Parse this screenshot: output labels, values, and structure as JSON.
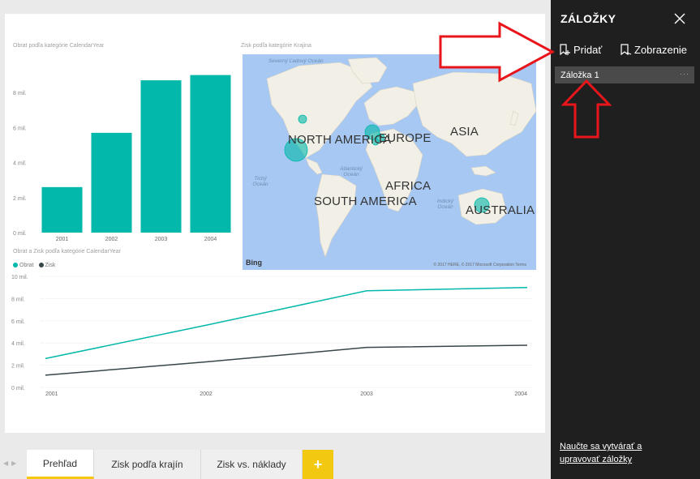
{
  "report": {
    "bar_title": "Obrat podľa kategórie CalendarYear",
    "map_title": "Zisk podľa kategórie Krajina",
    "line_title": "Obrat a Zisk podľa kategórie CalendarYear"
  },
  "map": {
    "continents": [
      "NORTH AMERICA",
      "EUROPE",
      "ASIA",
      "AFRICA",
      "SOUTH AMERICA",
      "AUSTRALIA"
    ],
    "oceans": [
      "Severný Ľadový Oceán",
      "Tichý Oceán",
      "Atlantický Oceán",
      "Indický Oceán"
    ],
    "bing_label": "Bing",
    "copyright": "© 2017 HERE, © 2017 Microsoft Corporation Terms"
  },
  "legend": {
    "obrat": "Obrat",
    "zisk": "Zisk"
  },
  "colors": {
    "teal": "#01b8aa",
    "dark": "#374649",
    "pane_bg": "#1f1f1f",
    "accent": "#f2c811"
  },
  "chart_data": [
    {
      "type": "bar",
      "title": "Obrat podľa kategórie CalendarYear",
      "categories": [
        "2001",
        "2002",
        "2003",
        "2004"
      ],
      "values": [
        2.6,
        5.7,
        8.7,
        9.0
      ],
      "ylim": [
        0,
        10
      ],
      "yticks": [
        "0 mil.",
        "2 mil.",
        "4 mil.",
        "6 mil.",
        "8 mil."
      ],
      "grid": false
    },
    {
      "type": "line",
      "title": "Obrat a Zisk podľa kategórie CalendarYear",
      "x": [
        "2001",
        "2002",
        "2003",
        "2004"
      ],
      "series": [
        {
          "name": "Obrat",
          "values": [
            2.6,
            5.6,
            8.7,
            9.0
          ]
        },
        {
          "name": "Zisk",
          "values": [
            1.1,
            2.3,
            3.6,
            3.8
          ]
        }
      ],
      "ylim": [
        0,
        10
      ],
      "yticks": [
        "0 mil.",
        "2 mil.",
        "4 mil.",
        "6 mil.",
        "8 mil.",
        "10 mil."
      ],
      "grid": true,
      "legend": "top-left"
    }
  ],
  "tabs": [
    "Prehľad",
    "Zisk podľa krajín",
    "Zisk vs. náklady"
  ],
  "add_tab_label": "+",
  "pane": {
    "title": "ZÁLOŽKY",
    "add_label": "Pridať",
    "view_label": "Zobrazenie",
    "bookmarks": [
      "Záložka 1"
    ],
    "more_label": "···",
    "learn_line1": "Naučte sa vytvárať a",
    "learn_line2": "upravovať záložky"
  }
}
